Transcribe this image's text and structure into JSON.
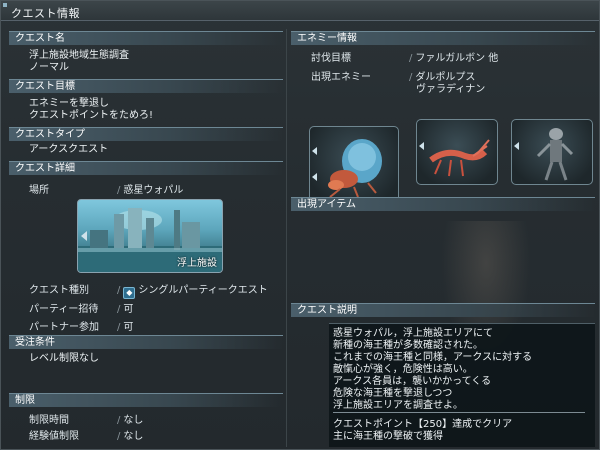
{
  "window": {
    "title": "クエスト情報"
  },
  "left": {
    "quest_name": {
      "header": "クエスト名",
      "lines": [
        "浮上施設地域生態調査",
        "ノーマル"
      ]
    },
    "quest_goal": {
      "header": "クエスト目標",
      "lines": [
        "エネミーを撃退し",
        "クエストポイントをためろ!"
      ]
    },
    "quest_type": {
      "header": "クエストタイプ",
      "value": "アークスクエスト"
    },
    "quest_detail": {
      "header": "クエスト詳細",
      "location_label": "場所",
      "location_value": "惑星ウォパル",
      "thumbnail_caption": "浮上施設",
      "quest_kind_label": "クエスト種別",
      "quest_kind_icon": "quest-type-icon",
      "quest_kind_value": "シングルパーティークエスト",
      "party_invite_label": "パーティー招待",
      "party_invite_value": "可",
      "partner_label": "パートナー参加",
      "partner_value": "可"
    },
    "conditions": {
      "header": "受注条件",
      "value": "レベル制限なし"
    },
    "limits": {
      "header": "制限",
      "time_label": "制限時間",
      "time_value": "なし",
      "exp_label": "経験値制限",
      "exp_value": "なし"
    }
  },
  "right": {
    "enemy_info": {
      "header": "エネミー情報",
      "target_label": "討伐目標",
      "target_value": "ファルガルボン 他",
      "appear_label": "出現エネミー",
      "appear_values": [
        "ダルポルプス",
        "ヴァラディナン"
      ]
    },
    "items": {
      "header": "出現アイテム"
    },
    "description": {
      "header": "クエスト説明",
      "lines": [
        "惑星ウォパル，浮上施設エリアにて",
        "新種の海王種が多数確認された。",
        "これまでの海王種と同様，アークスに対する",
        "敵愾心が強く，危険性は高い。",
        "アークス各員は，襲いかかってくる",
        "危険な海王種を撃退しつつ",
        "浮上施設エリアを調査せよ。"
      ],
      "footer_lines": [
        "クエストポイント【250】達成でクリア",
        "主に海王種の撃破で獲得"
      ]
    }
  }
}
